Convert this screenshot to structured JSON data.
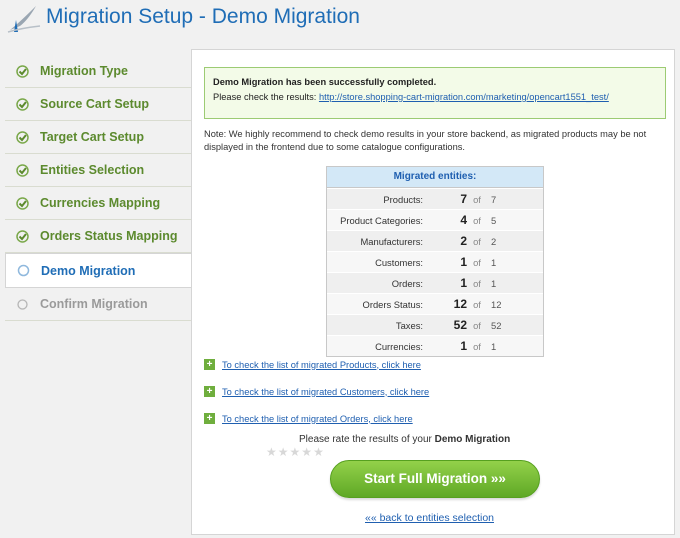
{
  "header": {
    "title": "Migration Setup - Demo Migration"
  },
  "sidebar": {
    "steps": [
      {
        "label": "Migration Type",
        "state": "done"
      },
      {
        "label": "Source Cart Setup",
        "state": "done"
      },
      {
        "label": "Target Cart Setup",
        "state": "done"
      },
      {
        "label": "Entities Selection",
        "state": "done"
      },
      {
        "label": "Currencies Mapping",
        "state": "done"
      },
      {
        "label": "Orders Status Mapping",
        "state": "done"
      },
      {
        "label": "Demo Migration",
        "state": "active"
      },
      {
        "label": "Confirm Migration",
        "state": "pending"
      }
    ]
  },
  "main": {
    "success": {
      "title": "Demo Migration has been successfully completed.",
      "check_text": "Please check the results: ",
      "link": "http://store.shopping-cart-migration.com/marketing/opencart1551_test/"
    },
    "note": "Note: We highly recommend to check demo results in your store backend, as migrated products may be not displayed in the frontend due to some catalogue configurations.",
    "entities": {
      "title": "Migrated entities:",
      "of_label": "of",
      "rows": [
        {
          "name": "Products:",
          "done": "7",
          "total": "7"
        },
        {
          "name": "Product Categories:",
          "done": "4",
          "total": "5"
        },
        {
          "name": "Manufacturers:",
          "done": "2",
          "total": "2"
        },
        {
          "name": "Customers:",
          "done": "1",
          "total": "1"
        },
        {
          "name": "Orders:",
          "done": "1",
          "total": "1"
        },
        {
          "name": "Orders Status:",
          "done": "12",
          "total": "12"
        },
        {
          "name": "Taxes:",
          "done": "52",
          "total": "52"
        },
        {
          "name": "Currencies:",
          "done": "1",
          "total": "1"
        }
      ]
    },
    "links": {
      "products": "To check the list of migrated Products, click here",
      "customers": "To check the list of migrated Customers, click here",
      "orders": "To check the list of migrated Orders, click here"
    },
    "rate": {
      "text": "Please rate the results of your ",
      "bold": "Demo Migration"
    },
    "start_button": "Start Full Migration »»",
    "back_link": "«« back to entities selection"
  },
  "colors": {
    "accent": "#1f6db6",
    "done": "#5c8a2e",
    "button": "#6fb834"
  }
}
